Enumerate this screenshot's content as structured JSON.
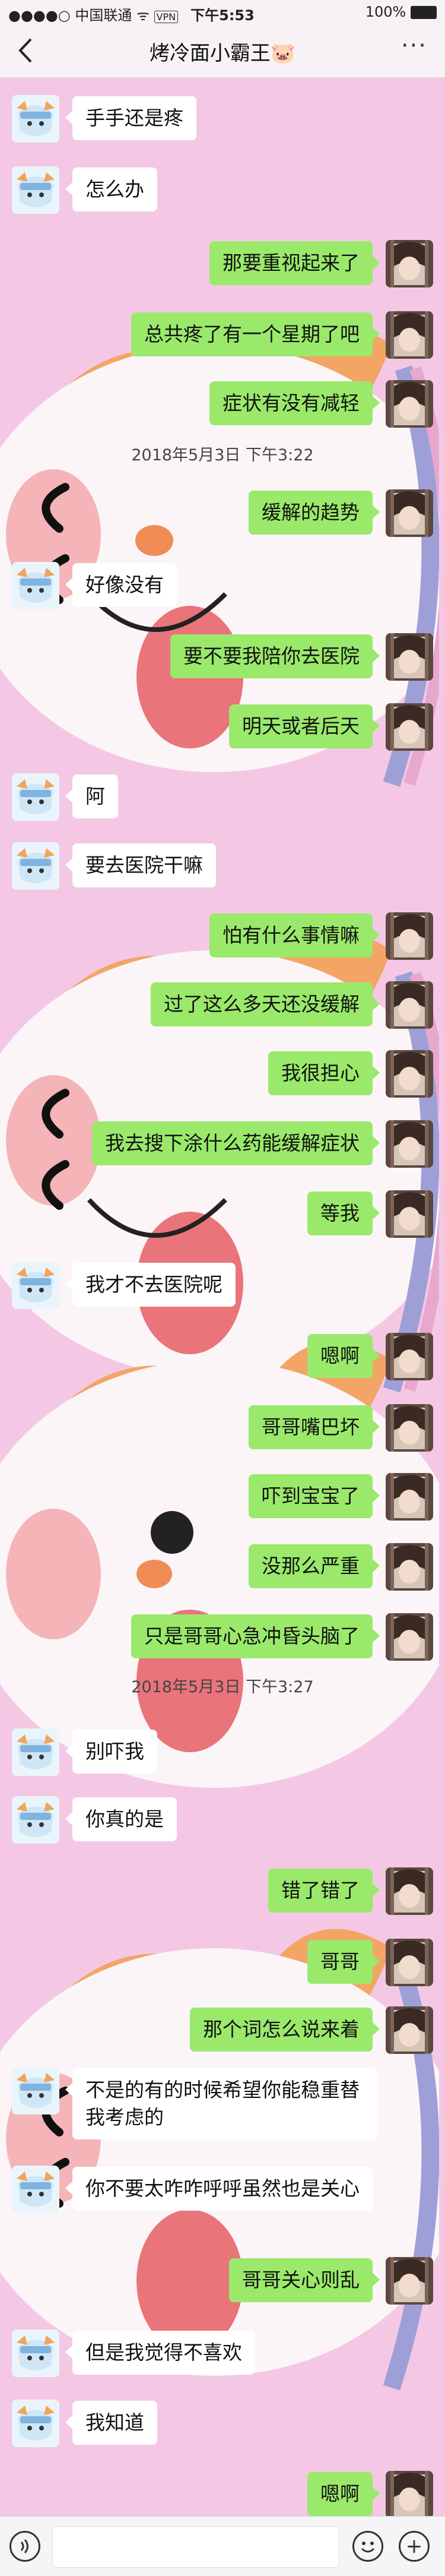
{
  "status_bar": {
    "carrier": "中国联通",
    "network": "VPN",
    "time": "下午5:53",
    "battery": "100%"
  },
  "nav": {
    "title": "烤冷面小霸王🐷",
    "more": "···"
  },
  "messages": [
    {
      "side": "in",
      "text": "手手还是疼"
    },
    {
      "side": "in",
      "text": "怎么办"
    },
    {
      "side": "out",
      "text": "那要重视起来了"
    },
    {
      "side": "out",
      "text": "总共疼了有一个星期了吧"
    },
    {
      "side": "out",
      "text": "症状有没有减轻"
    },
    {
      "side": "time",
      "text": "2018年5月3日 下午3:22"
    },
    {
      "side": "out",
      "text": "缓解的趋势"
    },
    {
      "side": "in",
      "text": "好像没有"
    },
    {
      "side": "out",
      "text": "要不要我陪你去医院"
    },
    {
      "side": "out",
      "text": "明天或者后天"
    },
    {
      "side": "in",
      "text": "阿"
    },
    {
      "side": "in",
      "text": "要去医院干嘛"
    },
    {
      "side": "out",
      "text": "怕有什么事情嘛"
    },
    {
      "side": "out",
      "text": "过了这么多天还没缓解"
    },
    {
      "side": "out",
      "text": "我很担心"
    },
    {
      "side": "out",
      "text": "我去搜下涂什么药能缓解症状"
    },
    {
      "side": "out",
      "text": "等我"
    },
    {
      "side": "in",
      "text": "我才不去医院呢"
    },
    {
      "side": "out",
      "text": "嗯啊"
    },
    {
      "side": "out",
      "text": "哥哥嘴巴坏"
    },
    {
      "side": "out",
      "text": "吓到宝宝了"
    },
    {
      "side": "out",
      "text": "没那么严重"
    },
    {
      "side": "out",
      "text": "只是哥哥心急冲昏头脑了"
    },
    {
      "side": "time",
      "text": "2018年5月3日 下午3:27"
    },
    {
      "side": "in",
      "text": "别吓我"
    },
    {
      "side": "in",
      "text": "你真的是"
    },
    {
      "side": "out",
      "text": "错了错了"
    },
    {
      "side": "out",
      "text": "哥哥"
    },
    {
      "side": "out",
      "text": "那个词怎么说来着"
    },
    {
      "side": "in",
      "text": "不是的有的时候希望你能稳重替我考虑的"
    },
    {
      "side": "in",
      "text": "你不要太咋咋呼呼虽然也是关心"
    },
    {
      "side": "out",
      "text": "哥哥关心则乱"
    },
    {
      "side": "in",
      "text": "但是我觉得不喜欢"
    },
    {
      "side": "in",
      "text": "我知道"
    },
    {
      "side": "out",
      "text": "嗯啊"
    }
  ],
  "input_bar": {
    "voice_icon": "voice-icon",
    "emoji_icon": "emoji-icon",
    "plus_icon": "plus-icon"
  },
  "colors": {
    "incoming_bubble": "#ffffff",
    "outgoing_bubble": "#9ae96b",
    "wallpaper": "#f4c8e4"
  }
}
